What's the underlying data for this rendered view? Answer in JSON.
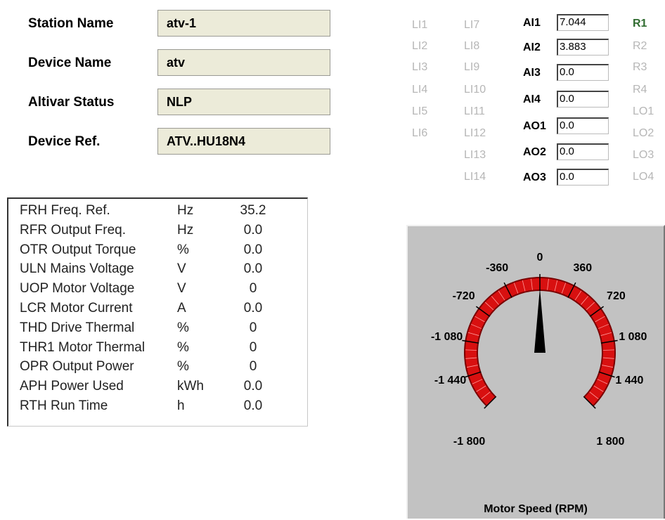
{
  "device": {
    "station_name_label": "Station Name",
    "station_name_value": "atv-1",
    "device_name_label": "Device Name",
    "device_name_value": "atv",
    "altivar_status_label": "Altivar Status",
    "altivar_status_value": "NLP",
    "device_ref_label": "Device Ref.",
    "device_ref_value": "ATV..HU18N4"
  },
  "io": {
    "li_col1": [
      "LI1",
      "LI2",
      "LI3",
      "LI4",
      "LI5",
      "LI6"
    ],
    "li_col2": [
      "LI7",
      "LI8",
      "LI9",
      "LI10",
      "LI11",
      "LI12",
      "LI13",
      "LI14"
    ],
    "analog": [
      {
        "label": "AI1",
        "value": "7.044"
      },
      {
        "label": "AI2",
        "value": "3.883"
      },
      {
        "label": "AI3",
        "value": "0.0"
      },
      {
        "label": "AI4",
        "value": "0.0"
      },
      {
        "label": "AO1",
        "value": "0.0"
      },
      {
        "label": "AO2",
        "value": "0.0"
      },
      {
        "label": "AO3",
        "value": "0.0"
      }
    ],
    "outputs": [
      "R1",
      "R2",
      "R3",
      "R4",
      "LO1",
      "LO2",
      "LO3",
      "LO4"
    ]
  },
  "parameters": [
    {
      "name": "FRH Freq. Ref.",
      "unit": "Hz",
      "value": "35.2"
    },
    {
      "name": "RFR Output Freq.",
      "unit": "Hz",
      "value": "0.0"
    },
    {
      "name": "OTR Output Torque",
      "unit": "%",
      "value": "0.0"
    },
    {
      "name": "ULN Mains Voltage",
      "unit": "V",
      "value": "0.0"
    },
    {
      "name": "UOP Motor Voltage",
      "unit": "V",
      "value": "0"
    },
    {
      "name": "LCR Motor Current",
      "unit": "A",
      "value": "0.0"
    },
    {
      "name": "THD Drive Thermal",
      "unit": "%",
      "value": "0"
    },
    {
      "name": "THR1 Motor Thermal",
      "unit": "%",
      "value": "0"
    },
    {
      "name": "OPR Output Power",
      "unit": "%",
      "value": "0"
    },
    {
      "name": "APH Power Used",
      "unit": "kWh",
      "value": "0.0"
    },
    {
      "name": "RTH Run Time",
      "unit": "h",
      "value": "0.0"
    }
  ],
  "gauge": {
    "title": "Motor Speed (RPM)",
    "min": -1800,
    "max": 1800,
    "value": 0,
    "tick_labels": [
      "-1 800",
      "-1 440",
      "-1 080",
      "-720",
      "-360",
      "0",
      "360",
      "720",
      "1 080",
      "1 440",
      "1 800"
    ],
    "colors": {
      "band": "#d81010",
      "band_dark": "#7a0000",
      "needle": "#000000",
      "panel": "#c2c2c2"
    }
  }
}
